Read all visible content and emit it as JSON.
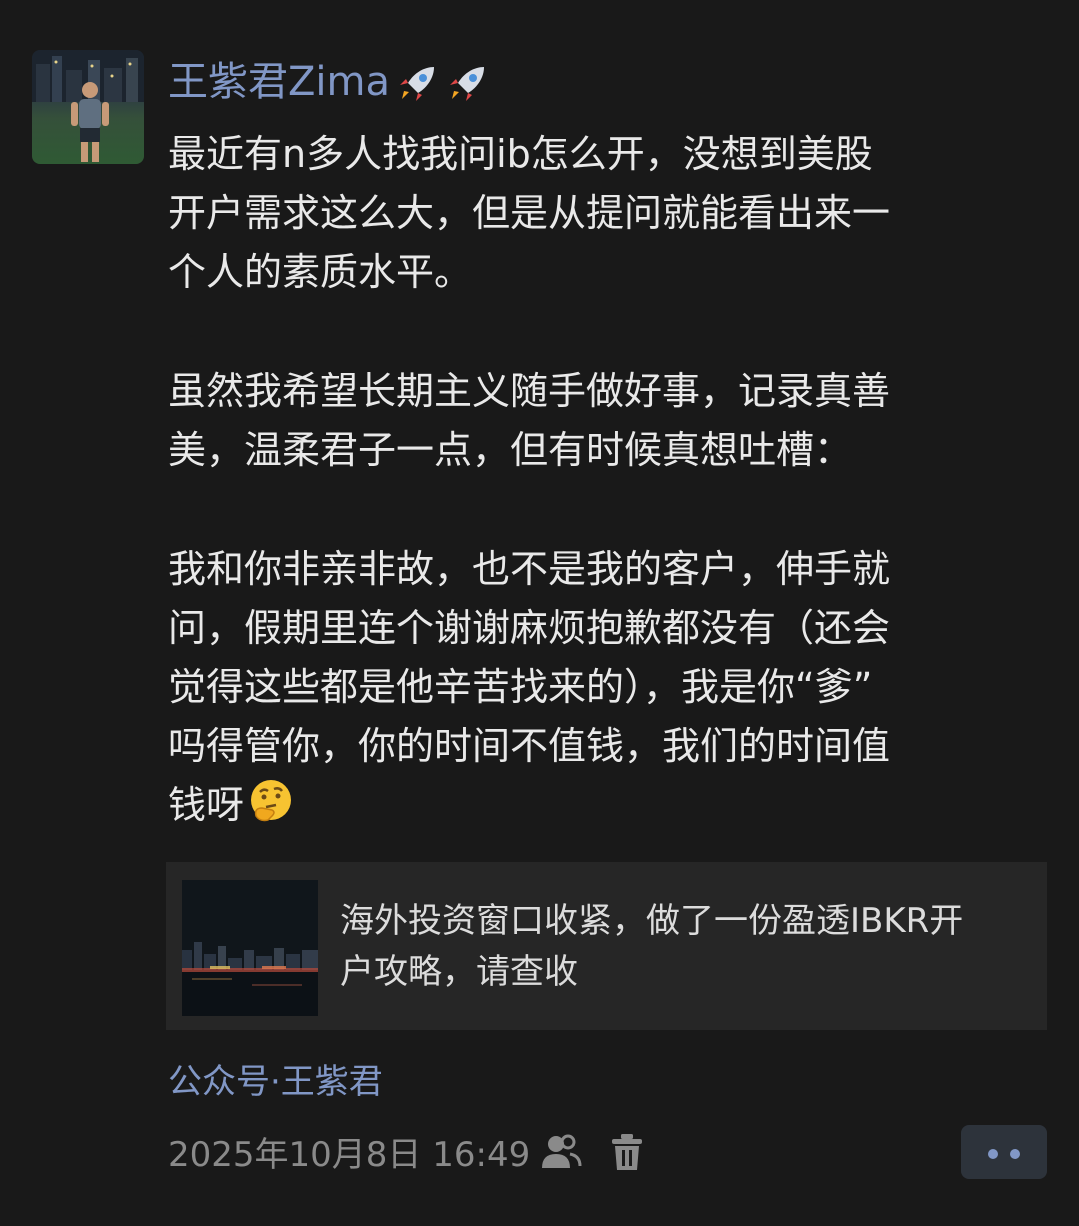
{
  "post": {
    "author_name": "王紫君Zima",
    "author_emoji": [
      "rocket-icon",
      "rocket-icon"
    ],
    "paragraphs": [
      "最近有n多人找我问ib怎么开，没想到美股\n开户需求这么大，但是从提问就能看出来一\n个人的素质水平。",
      "虽然我希望长期主义随手做好事，记录真善\n美，温柔君子一点，但有时候真想吐槽：",
      "我和你非亲非故，也不是我的客户，伸手就\n问，假期里连个谢谢麻烦抱歉都没有（还会\n觉得这些都是他辛苦找来的），我是你“爹”\n吗得管你，你的时间不值钱，我们的时间值\n钱呀"
    ],
    "trailing_emoji": "thinking-face-icon",
    "link_card": {
      "title": "海外投资窗口收紧，做了一份盈透IBKR开\n户攻略，请查收"
    },
    "source": "公众号·王紫君",
    "timestamp": "2025年10月8日 16:49"
  },
  "colors": {
    "background": "#191919",
    "name_link": "#8197c6",
    "text": "#e9e9e9",
    "meta": "#8a8a8a",
    "card_bg": "#262626"
  }
}
